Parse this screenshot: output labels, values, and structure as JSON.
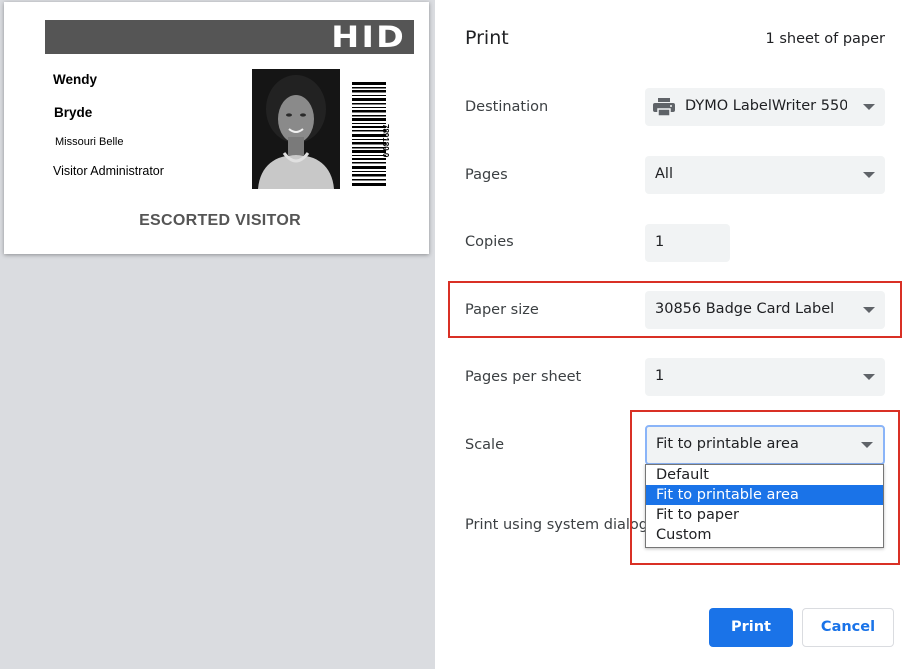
{
  "badge": {
    "logo": "HID",
    "first_name": "Wendy",
    "last_name": "Bryde",
    "company": "Missouri Belle",
    "job_title": "Visitor Administrator",
    "status": "ESCORTED VISITOR",
    "barcode_number": "789180 0"
  },
  "settings": {
    "title": "Print",
    "sheet_count": "1 sheet of paper",
    "destination_label": "Destination",
    "destination_value": "DYMO LabelWriter 550",
    "pages_label": "Pages",
    "pages_value": "All",
    "copies_label": "Copies",
    "copies_value": "1",
    "paper_size_label": "Paper size",
    "paper_size_value": "30856 Badge Card Label",
    "pages_per_sheet_label": "Pages per sheet",
    "pages_per_sheet_value": "1",
    "scale_label": "Scale",
    "scale_value": "Fit to printable area",
    "scale_options": [
      "Default",
      "Fit to printable area",
      "Fit to paper",
      "Custom"
    ],
    "system_dialog_label": "Print using system dialog"
  },
  "buttons": {
    "print": "Print",
    "cancel": "Cancel"
  },
  "colors": {
    "accent": "#1a73e8",
    "highlight": "#d93025",
    "preview_bg": "#dadce0",
    "field_bg": "#f1f3f4"
  }
}
